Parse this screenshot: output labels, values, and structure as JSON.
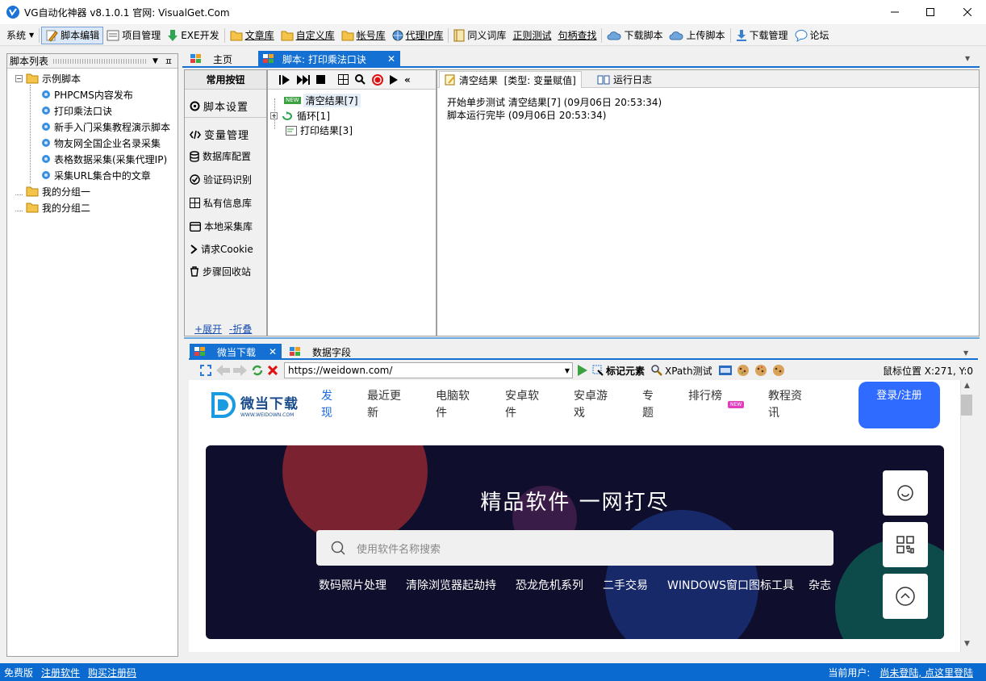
{
  "window": {
    "title": "VG自动化神器 v8.1.0.1    官网: VisualGet.Com"
  },
  "toolbar": {
    "items": [
      {
        "label": "系统",
        "icon": "dropdown-icon"
      },
      {
        "label": "脚本编辑",
        "icon": "pen-icon",
        "active": true
      },
      {
        "label": "项目管理",
        "icon": "project-icon"
      },
      {
        "label": "EXE开发",
        "icon": "download-arrow-icon"
      },
      {
        "label": "文章库",
        "icon": "folder-icon"
      },
      {
        "label": "自定义库",
        "icon": "folder-icon"
      },
      {
        "label": "帐号库",
        "icon": "folder-icon"
      },
      {
        "label": "代理IP库",
        "icon": "globe-icon"
      },
      {
        "label": "同义词库",
        "icon": "book-icon"
      },
      {
        "label": "正则测试",
        "icon": ""
      },
      {
        "label": "句柄查找",
        "icon": ""
      },
      {
        "label": "下载脚本",
        "icon": "cloud-download-icon"
      },
      {
        "label": "上传脚本",
        "icon": "cloud-upload-icon"
      },
      {
        "label": "下载管理",
        "icon": "download-box-icon"
      },
      {
        "label": "论坛",
        "icon": "chat-icon"
      }
    ]
  },
  "left_panel": {
    "title": "脚本列表",
    "tree": [
      {
        "label": "示例脚本",
        "level": 0,
        "icon": "folder-icon"
      },
      {
        "label": "PHPCMS内容发布",
        "level": 1,
        "icon": "script-icon"
      },
      {
        "label": "打印乘法口诀",
        "level": 1,
        "icon": "script-icon"
      },
      {
        "label": "新手入门采集教程演示脚本",
        "level": 1,
        "icon": "script-icon"
      },
      {
        "label": "物友网全国企业名录采集",
        "level": 1,
        "icon": "script-icon"
      },
      {
        "label": "表格数据采集(采集代理IP)",
        "level": 1,
        "icon": "script-icon"
      },
      {
        "label": "采集URL集合中的文章",
        "level": 1,
        "icon": "script-icon"
      },
      {
        "label": "我的分组一",
        "level": 0,
        "icon": "folder-icon"
      },
      {
        "label": "我的分组二",
        "level": 0,
        "icon": "folder-icon"
      }
    ]
  },
  "tabs": {
    "home": "主页",
    "script": "脚本: 打印乘法口诀"
  },
  "common": {
    "title": "常用按钮",
    "buttons": [
      "脚本设置",
      "变量管理",
      "数据库配置",
      "验证码识别",
      "私有信息库",
      "本地采集库",
      "请求Cookie",
      "步骤回收站"
    ],
    "expand": "+展开",
    "collapse": "-折叠"
  },
  "steps": [
    {
      "label": "清空结果[7]",
      "badge": "NEW"
    },
    {
      "label": "循环[1]"
    },
    {
      "label": "打印结果[3]"
    }
  ],
  "result_tabs": {
    "clear": "清空结果  [类型: 变量赋值]",
    "log": "运行日志"
  },
  "log": [
    "开始单步测试 清空结果[7] (09月06日 20:53:34)",
    "脚本运行完毕 (09月06日 20:53:34)"
  ],
  "browser": {
    "tabs": [
      "微当下载",
      "数据字段"
    ],
    "url": "https://weidown.com/",
    "mark": "标记元素",
    "xpath": "XPath测试",
    "mouse": "鼠标位置 X:271, Y:0"
  },
  "site": {
    "logo": "微当下载",
    "logo_sub": "WWW.WEIDOWN.COM",
    "nav": [
      "发现",
      "最近更新",
      "电脑软件",
      "安卓软件",
      "安卓游戏",
      "专题",
      "排行榜",
      "教程资讯"
    ],
    "new_badge": "NEW",
    "login": "登录/注册",
    "hero": "精品软件 一网打尽",
    "search_placeholder": "使用软件名称搜索",
    "hot": [
      "数码照片处理",
      "清除浏览器起劫持",
      "恐龙危机系列",
      "二手交易",
      "WINDOWS窗口图标工具",
      "杂志"
    ]
  },
  "status": {
    "edition": "免费版",
    "register": "注册软件",
    "buy": "购买注册码",
    "user_label": "当前用户:",
    "user_link": "尚未登陆, 点这里登陆"
  },
  "colors": {
    "accent": "#0a6ad0",
    "tab_active": "#1570d4",
    "login_btn": "#2f6bff",
    "hero_bg": "#0f0e2c"
  }
}
